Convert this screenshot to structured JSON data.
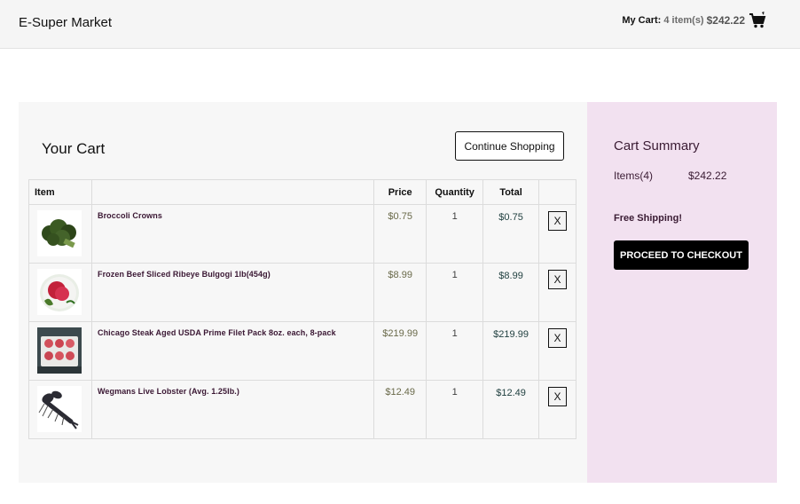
{
  "header": {
    "brand": "E-Super Market",
    "cart_label": "My Cart:",
    "cart_count": "4 item(s)",
    "cart_total": "$242.22",
    "cart_icon": "shopping-cart-icon"
  },
  "cart": {
    "title": "Your Cart",
    "continue_label": "Continue Shopping",
    "columns": [
      "Item",
      "",
      "Price",
      "Quantity",
      "Total",
      ""
    ],
    "remove_label": "X",
    "items": [
      {
        "name": "Broccoli Crowns",
        "price": "$0.75",
        "qty": "1",
        "total": "$0.75",
        "image": "broccoli-image"
      },
      {
        "name": "Frozen Beef Sliced Ribeye Bulgogi 1lb(454g)",
        "price": "$8.99",
        "qty": "1",
        "total": "$8.99",
        "image": "beef-image"
      },
      {
        "name": "Chicago Steak Aged USDA Prime Filet Pack 8oz. each, 8-pack",
        "price": "$219.99",
        "qty": "1",
        "total": "$219.99",
        "image": "steak-image"
      },
      {
        "name": "Wegmans Live Lobster (Avg. 1.25lb.)",
        "price": "$12.49",
        "qty": "1",
        "total": "$12.49",
        "image": "lobster-image"
      }
    ]
  },
  "summary": {
    "title": "Cart Summary",
    "items_label": "Items(4)",
    "items_amount": "$242.22",
    "shipping": "Free Shipping!",
    "checkout_label": "PROCEED TO CHECKOUT"
  },
  "colors": {
    "header_bg": "#f5f5f5",
    "panel_bg": "#f7f7f7",
    "summary_bg": "#f2e1f0",
    "checkout_bg": "#000000"
  }
}
